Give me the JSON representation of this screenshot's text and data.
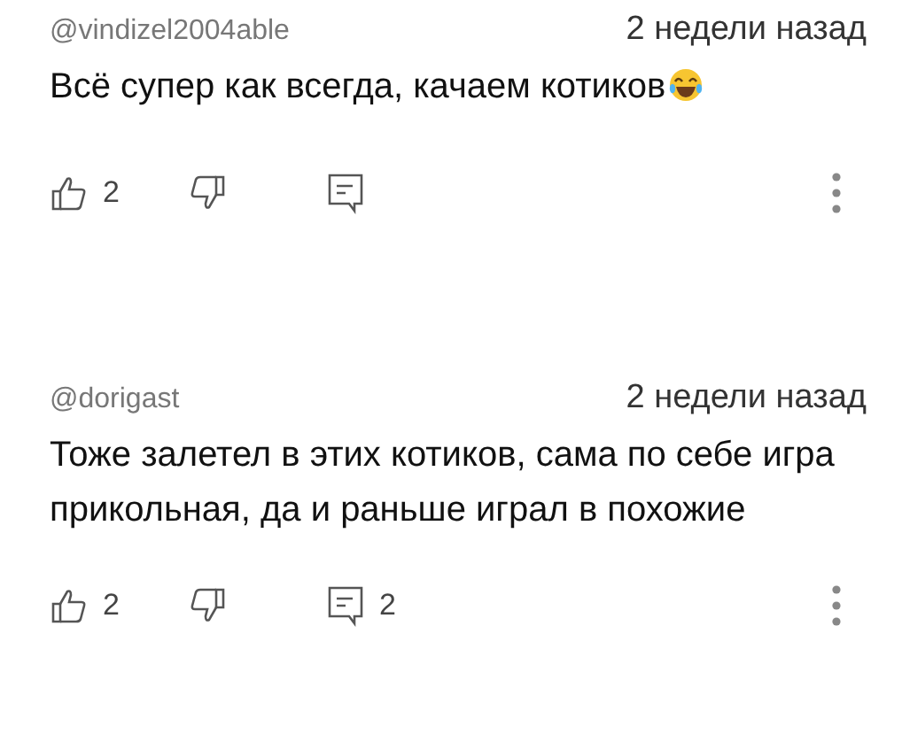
{
  "comments": [
    {
      "author": "@vindizel2004able",
      "time": "2 недели назад",
      "text": "Всё супер как всегда, качаем котиков",
      "emoji": true,
      "likes": "2"
    },
    {
      "author": "@dorigast",
      "time": "2 недели назад",
      "text": "Тоже залетел в этих котиков, сама по себе игра прикольная, да и раньше играл в похожие",
      "emoji": false,
      "likes": "2",
      "replies": "2"
    }
  ]
}
